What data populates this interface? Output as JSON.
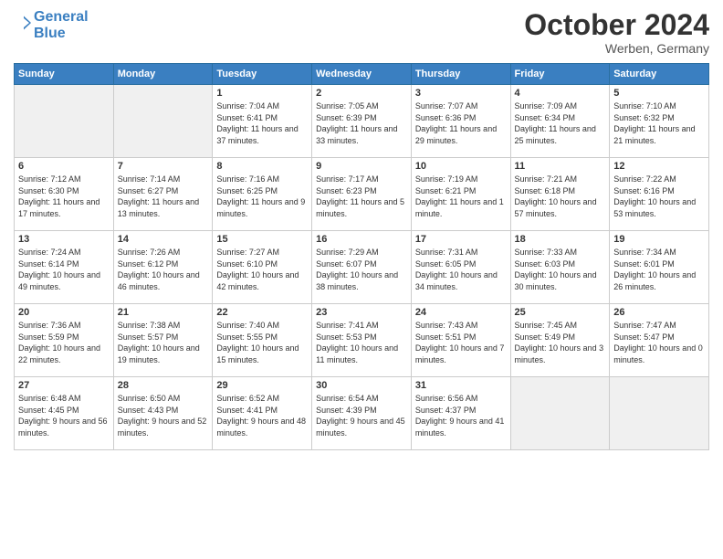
{
  "header": {
    "logo_line1": "General",
    "logo_line2": "Blue",
    "month": "October 2024",
    "location": "Werben, Germany"
  },
  "days_of_week": [
    "Sunday",
    "Monday",
    "Tuesday",
    "Wednesday",
    "Thursday",
    "Friday",
    "Saturday"
  ],
  "weeks": [
    [
      {
        "day": "",
        "empty": true
      },
      {
        "day": "",
        "empty": true
      },
      {
        "day": "1",
        "sunrise": "Sunrise: 7:04 AM",
        "sunset": "Sunset: 6:41 PM",
        "daylight": "Daylight: 11 hours and 37 minutes."
      },
      {
        "day": "2",
        "sunrise": "Sunrise: 7:05 AM",
        "sunset": "Sunset: 6:39 PM",
        "daylight": "Daylight: 11 hours and 33 minutes."
      },
      {
        "day": "3",
        "sunrise": "Sunrise: 7:07 AM",
        "sunset": "Sunset: 6:36 PM",
        "daylight": "Daylight: 11 hours and 29 minutes."
      },
      {
        "day": "4",
        "sunrise": "Sunrise: 7:09 AM",
        "sunset": "Sunset: 6:34 PM",
        "daylight": "Daylight: 11 hours and 25 minutes."
      },
      {
        "day": "5",
        "sunrise": "Sunrise: 7:10 AM",
        "sunset": "Sunset: 6:32 PM",
        "daylight": "Daylight: 11 hours and 21 minutes."
      }
    ],
    [
      {
        "day": "6",
        "sunrise": "Sunrise: 7:12 AM",
        "sunset": "Sunset: 6:30 PM",
        "daylight": "Daylight: 11 hours and 17 minutes."
      },
      {
        "day": "7",
        "sunrise": "Sunrise: 7:14 AM",
        "sunset": "Sunset: 6:27 PM",
        "daylight": "Daylight: 11 hours and 13 minutes."
      },
      {
        "day": "8",
        "sunrise": "Sunrise: 7:16 AM",
        "sunset": "Sunset: 6:25 PM",
        "daylight": "Daylight: 11 hours and 9 minutes."
      },
      {
        "day": "9",
        "sunrise": "Sunrise: 7:17 AM",
        "sunset": "Sunset: 6:23 PM",
        "daylight": "Daylight: 11 hours and 5 minutes."
      },
      {
        "day": "10",
        "sunrise": "Sunrise: 7:19 AM",
        "sunset": "Sunset: 6:21 PM",
        "daylight": "Daylight: 11 hours and 1 minute."
      },
      {
        "day": "11",
        "sunrise": "Sunrise: 7:21 AM",
        "sunset": "Sunset: 6:18 PM",
        "daylight": "Daylight: 10 hours and 57 minutes."
      },
      {
        "day": "12",
        "sunrise": "Sunrise: 7:22 AM",
        "sunset": "Sunset: 6:16 PM",
        "daylight": "Daylight: 10 hours and 53 minutes."
      }
    ],
    [
      {
        "day": "13",
        "sunrise": "Sunrise: 7:24 AM",
        "sunset": "Sunset: 6:14 PM",
        "daylight": "Daylight: 10 hours and 49 minutes."
      },
      {
        "day": "14",
        "sunrise": "Sunrise: 7:26 AM",
        "sunset": "Sunset: 6:12 PM",
        "daylight": "Daylight: 10 hours and 46 minutes."
      },
      {
        "day": "15",
        "sunrise": "Sunrise: 7:27 AM",
        "sunset": "Sunset: 6:10 PM",
        "daylight": "Daylight: 10 hours and 42 minutes."
      },
      {
        "day": "16",
        "sunrise": "Sunrise: 7:29 AM",
        "sunset": "Sunset: 6:07 PM",
        "daylight": "Daylight: 10 hours and 38 minutes."
      },
      {
        "day": "17",
        "sunrise": "Sunrise: 7:31 AM",
        "sunset": "Sunset: 6:05 PM",
        "daylight": "Daylight: 10 hours and 34 minutes."
      },
      {
        "day": "18",
        "sunrise": "Sunrise: 7:33 AM",
        "sunset": "Sunset: 6:03 PM",
        "daylight": "Daylight: 10 hours and 30 minutes."
      },
      {
        "day": "19",
        "sunrise": "Sunrise: 7:34 AM",
        "sunset": "Sunset: 6:01 PM",
        "daylight": "Daylight: 10 hours and 26 minutes."
      }
    ],
    [
      {
        "day": "20",
        "sunrise": "Sunrise: 7:36 AM",
        "sunset": "Sunset: 5:59 PM",
        "daylight": "Daylight: 10 hours and 22 minutes."
      },
      {
        "day": "21",
        "sunrise": "Sunrise: 7:38 AM",
        "sunset": "Sunset: 5:57 PM",
        "daylight": "Daylight: 10 hours and 19 minutes."
      },
      {
        "day": "22",
        "sunrise": "Sunrise: 7:40 AM",
        "sunset": "Sunset: 5:55 PM",
        "daylight": "Daylight: 10 hours and 15 minutes."
      },
      {
        "day": "23",
        "sunrise": "Sunrise: 7:41 AM",
        "sunset": "Sunset: 5:53 PM",
        "daylight": "Daylight: 10 hours and 11 minutes."
      },
      {
        "day": "24",
        "sunrise": "Sunrise: 7:43 AM",
        "sunset": "Sunset: 5:51 PM",
        "daylight": "Daylight: 10 hours and 7 minutes."
      },
      {
        "day": "25",
        "sunrise": "Sunrise: 7:45 AM",
        "sunset": "Sunset: 5:49 PM",
        "daylight": "Daylight: 10 hours and 3 minutes."
      },
      {
        "day": "26",
        "sunrise": "Sunrise: 7:47 AM",
        "sunset": "Sunset: 5:47 PM",
        "daylight": "Daylight: 10 hours and 0 minutes."
      }
    ],
    [
      {
        "day": "27",
        "sunrise": "Sunrise: 6:48 AM",
        "sunset": "Sunset: 4:45 PM",
        "daylight": "Daylight: 9 hours and 56 minutes."
      },
      {
        "day": "28",
        "sunrise": "Sunrise: 6:50 AM",
        "sunset": "Sunset: 4:43 PM",
        "daylight": "Daylight: 9 hours and 52 minutes."
      },
      {
        "day": "29",
        "sunrise": "Sunrise: 6:52 AM",
        "sunset": "Sunset: 4:41 PM",
        "daylight": "Daylight: 9 hours and 48 minutes."
      },
      {
        "day": "30",
        "sunrise": "Sunrise: 6:54 AM",
        "sunset": "Sunset: 4:39 PM",
        "daylight": "Daylight: 9 hours and 45 minutes."
      },
      {
        "day": "31",
        "sunrise": "Sunrise: 6:56 AM",
        "sunset": "Sunset: 4:37 PM",
        "daylight": "Daylight: 9 hours and 41 minutes."
      },
      {
        "day": "",
        "empty": true
      },
      {
        "day": "",
        "empty": true
      }
    ]
  ]
}
